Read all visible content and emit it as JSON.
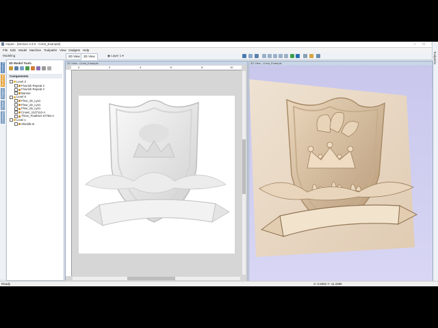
{
  "window": {
    "title": "Aspire - [Section 3.3.0 - Crest_Example]",
    "min": "–",
    "max": "□",
    "close": "✕"
  },
  "menu": [
    "File",
    "Edit",
    "Model",
    "Machine",
    "Toolpaths",
    "View",
    "Gadgets",
    "Help"
  ],
  "toolbar": {
    "mode_label": "Modeling",
    "tab_2d": "2D View",
    "tab_3d": "3D View",
    "layer_label": "Layer 1"
  },
  "right_strip": {
    "label": "Toolpaths"
  },
  "left_tabs": [
    "Drawing",
    "Modeling",
    "Project",
    "Clipart",
    "Learning"
  ],
  "panel": {
    "title": "3D Model Tools",
    "components_header": "Components",
    "tree": [
      {
        "label": "Level 3",
        "level": 0
      },
      {
        "label": "Flourish Repeat 2",
        "level": 1
      },
      {
        "label": "Flourish Repeat 2",
        "level": 1
      },
      {
        "label": "Banner",
        "level": 1
      },
      {
        "label": "Level 8",
        "level": 0
      },
      {
        "label": "Fleur_de_Lys1",
        "level": 1
      },
      {
        "label": "Fleur_de_Lys1",
        "level": 1
      },
      {
        "label": "Fleur_de_Lys1",
        "level": 1
      },
      {
        "label": "Crown_1127112-A",
        "level": 1
      },
      {
        "label": "Three_Feathers 57755-A",
        "level": 1
      },
      {
        "label": "Level 1",
        "level": 0
      },
      {
        "label": "Shield5-st",
        "level": 1
      }
    ]
  },
  "view2d": {
    "header": "2D View - Crest_Example",
    "ruler_ticks": [
      "0",
      "2",
      "4",
      "6",
      "8",
      "10"
    ]
  },
  "view3d": {
    "header": "3D View - Crest_Example"
  },
  "status": {
    "left": "Ready",
    "right": "X: 0.6052 Y: 11.3385"
  }
}
